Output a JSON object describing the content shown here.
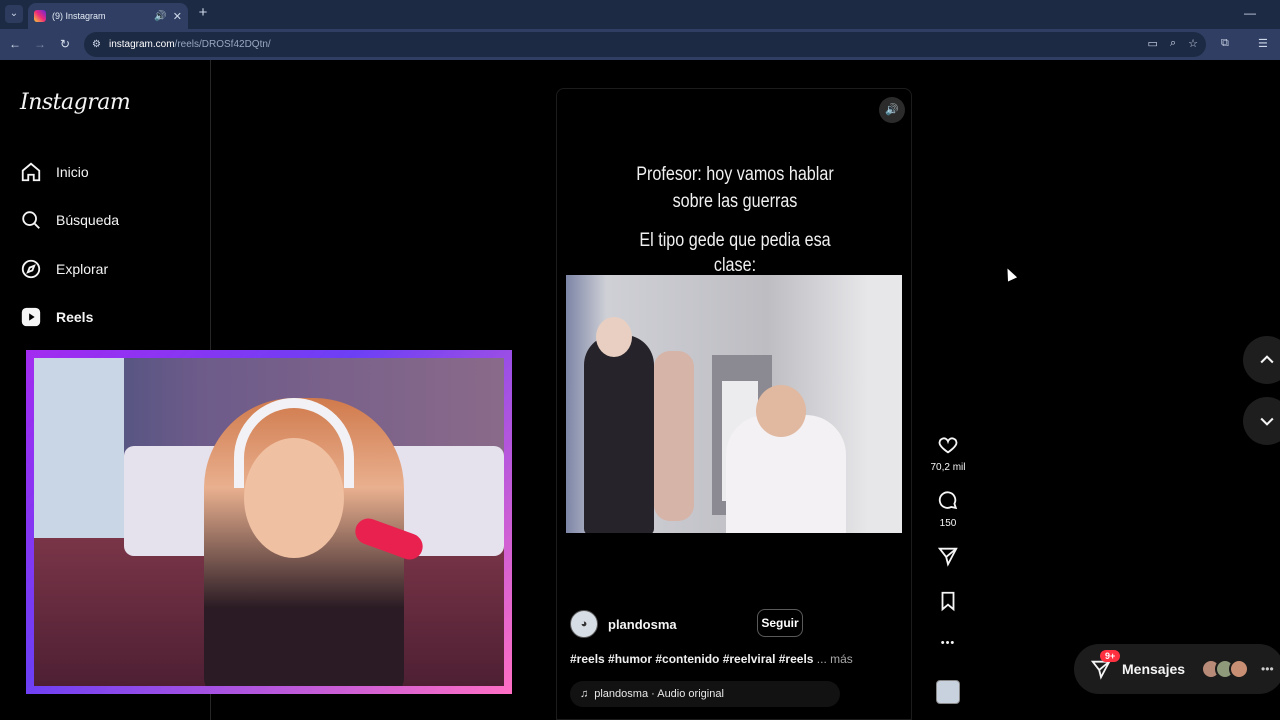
{
  "browser": {
    "tab_title": "(9) Instagram",
    "tab_audio_icon": "🔊",
    "tab_close_icon": "✕",
    "new_tab_icon": "+",
    "tab_menu_icon": "⌄",
    "minimize_icon": "—",
    "url_domain": "instagram.com",
    "url_path": "/reels/DROSf42DQtn/",
    "back_icon": "←",
    "forward_icon": "→",
    "reload_icon": "↻",
    "site_info_icon": "⚙"
  },
  "sidebar": {
    "logo": "Instagram",
    "items": [
      {
        "label": "Inicio"
      },
      {
        "label": "Búsqueda"
      },
      {
        "label": "Explorar"
      },
      {
        "label": "Reels"
      }
    ]
  },
  "reel": {
    "volume_icon": "🔊",
    "caption_line1": "Profesor: hoy vamos hablar",
    "caption_line2": "sobre las guerras",
    "caption_line3": "El tipo gede que pedia esa",
    "caption_line4": "clase:",
    "author": "plandosma",
    "follow_label": "Seguir",
    "tags": "#reels #humor #contenido #reelviral #reels",
    "more_label": "... más",
    "audio_label": "plandosma · Audio original",
    "audio_icon": "♫"
  },
  "actions": {
    "likes": "70,2 mil",
    "comments": "150",
    "more_icon": "•••"
  },
  "messages": {
    "label": "Mensajes",
    "badge": "9+",
    "dots": "•••"
  },
  "colors": {
    "accent_badge": "#ff3040",
    "chrome_dark": "#1d2a44",
    "chrome_light": "#2f3e62"
  }
}
